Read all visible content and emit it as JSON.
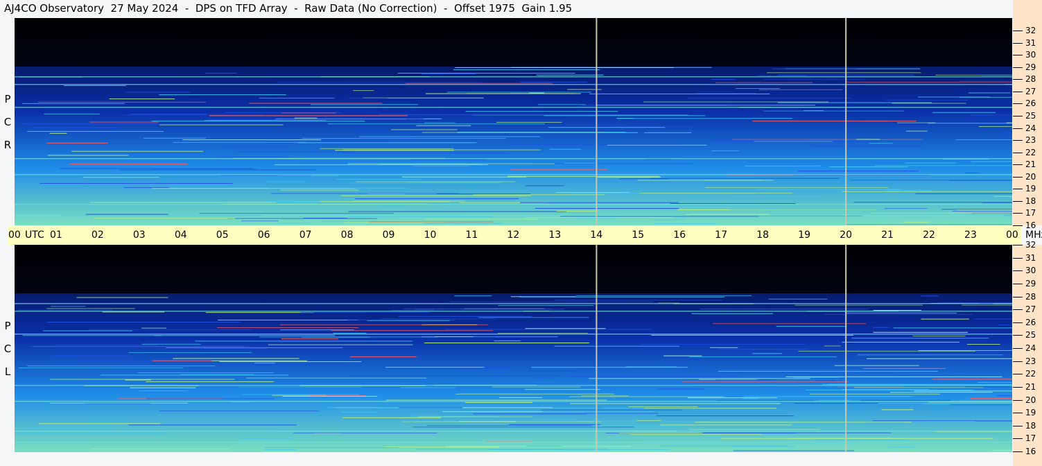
{
  "title": "AJ4CO Observatory  27 May 2024  -  DPS on TFD Array  -  Raw Data (No Correction)  -  Offset 1975  Gain 1.95",
  "panels": {
    "top": {
      "polarization_letters": [
        "R",
        "C",
        "P"
      ]
    },
    "bottom": {
      "polarization_letters": [
        "L",
        "C",
        "P"
      ]
    }
  },
  "time_axis": {
    "utc_label": "UTC",
    "mhz_label": "MHz",
    "hour_labels": [
      "00",
      "01",
      "02",
      "03",
      "04",
      "05",
      "06",
      "07",
      "08",
      "09",
      "10",
      "11",
      "12",
      "13",
      "14",
      "15",
      "16",
      "17",
      "18",
      "19",
      "20",
      "21",
      "22",
      "23",
      "00"
    ]
  },
  "freq_axis": {
    "labels": [
      "32",
      "31",
      "30",
      "29",
      "28",
      "27",
      "26",
      "25",
      "24",
      "23",
      "22",
      "21",
      "20",
      "19",
      "18",
      "17",
      "16"
    ]
  },
  "colors": {
    "background": "#000000",
    "noise_low": "#0a2fa8",
    "noise_mid": "#1e8ce8",
    "noise_high": "#7ae0c0",
    "rfi_hot": "#ff6060",
    "time_bar": "#ffffc0",
    "freq_axis_bg": "#ffe4c8"
  }
}
